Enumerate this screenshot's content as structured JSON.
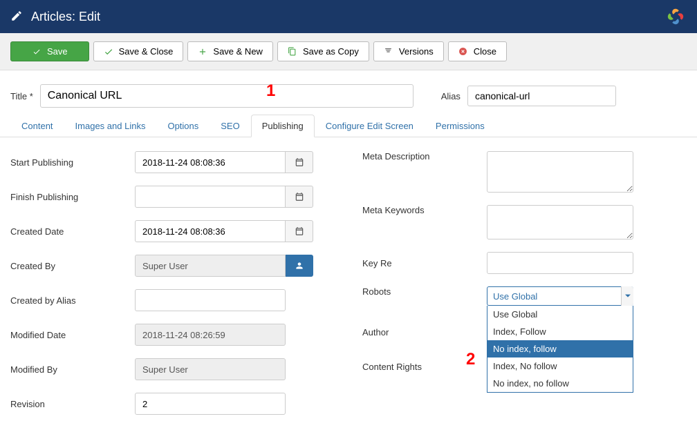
{
  "header": {
    "title": "Articles: Edit"
  },
  "toolbar": {
    "save": "Save",
    "save_close": "Save & Close",
    "save_new": "Save & New",
    "save_copy": "Save as Copy",
    "versions": "Versions",
    "close": "Close"
  },
  "form": {
    "title_label": "Title *",
    "title_value": "Canonical URL",
    "alias_label": "Alias",
    "alias_value": "canonical-url"
  },
  "tabs": [
    {
      "id": "content",
      "label": "Content"
    },
    {
      "id": "images",
      "label": "Images and Links"
    },
    {
      "id": "options",
      "label": "Options"
    },
    {
      "id": "seo",
      "label": "SEO"
    },
    {
      "id": "publishing",
      "label": "Publishing"
    },
    {
      "id": "configure",
      "label": "Configure Edit Screen"
    },
    {
      "id": "permissions",
      "label": "Permissions"
    }
  ],
  "active_tab": "publishing",
  "annotations": {
    "one": "1",
    "two": "2"
  },
  "left_fields": {
    "start_publishing": {
      "label": "Start Publishing",
      "value": "2018-11-24 08:08:36"
    },
    "finish_publishing": {
      "label": "Finish Publishing",
      "value": ""
    },
    "created_date": {
      "label": "Created Date",
      "value": "2018-11-24 08:08:36"
    },
    "created_by": {
      "label": "Created By",
      "value": "Super User"
    },
    "created_by_alias": {
      "label": "Created by Alias",
      "value": ""
    },
    "modified_date": {
      "label": "Modified Date",
      "value": "2018-11-24 08:26:59"
    },
    "modified_by": {
      "label": "Modified By",
      "value": "Super User"
    },
    "revision": {
      "label": "Revision",
      "value": "2"
    }
  },
  "right_fields": {
    "meta_description": {
      "label": "Meta Description",
      "value": ""
    },
    "meta_keywords": {
      "label": "Meta Keywords",
      "value": ""
    },
    "key_reference": {
      "label": "Key Re",
      "value": ""
    },
    "robots": {
      "label": "Robots",
      "selected": "Use Global",
      "options": [
        "Use Global",
        "Index, Follow",
        "No index, follow",
        "Index, No follow",
        "No index, no follow"
      ],
      "highlighted_index": 2
    },
    "author": {
      "label": "Author"
    },
    "content_rights": {
      "label": "Content Rights"
    }
  }
}
